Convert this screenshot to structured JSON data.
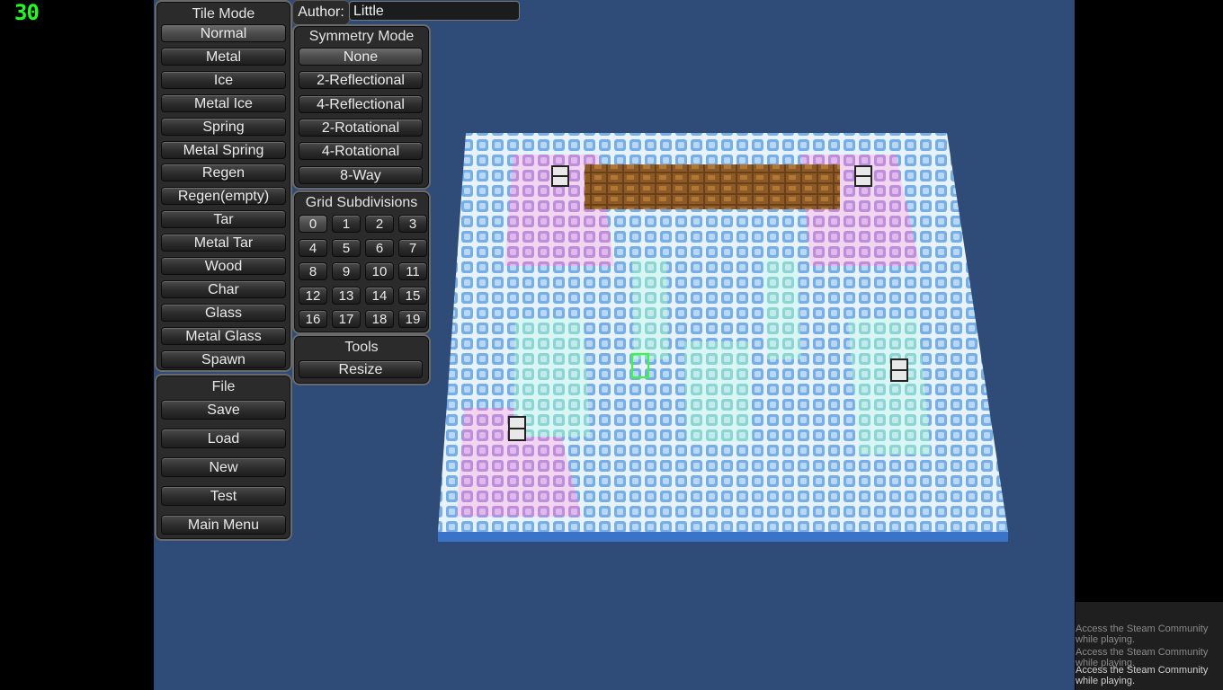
{
  "fps": "30",
  "author": {
    "label": "Author:",
    "value": "Little"
  },
  "tile_mode": {
    "title": "Tile Mode",
    "items": [
      "Normal",
      "Metal",
      "Ice",
      "Metal Ice",
      "Spring",
      "Metal Spring",
      "Regen",
      "Regen(empty)",
      "Tar",
      "Metal Tar",
      "Wood",
      "Char",
      "Glass",
      "Metal Glass",
      "Spawn"
    ],
    "selected": "Normal"
  },
  "symmetry_mode": {
    "title": "Symmetry Mode",
    "items": [
      "None",
      "2-Reflectional",
      "4-Reflectional",
      "2-Rotational",
      "4-Rotational",
      "8-Way"
    ],
    "selected": "None"
  },
  "grid_subdivisions": {
    "title": "Grid Subdivisions",
    "items": [
      "0",
      "1",
      "2",
      "3",
      "4",
      "5",
      "6",
      "7",
      "8",
      "9",
      "10",
      "11",
      "12",
      "13",
      "14",
      "15",
      "16",
      "17",
      "18",
      "19"
    ],
    "selected": "0"
  },
  "tools": {
    "title": "Tools",
    "items": [
      "Resize"
    ]
  },
  "file": {
    "title": "File",
    "items": [
      "Save",
      "Load",
      "New",
      "Test",
      "Main Menu"
    ]
  },
  "steam_notifications": [
    "Access the Steam Community while playing.",
    "Access the Steam Community while playing.",
    "Access the Steam Community while playing."
  ],
  "colors": {
    "viewport_bg": "#2f4c78",
    "ice": "#dbeeff",
    "ice_tile": "#6fa6e0",
    "pink": "#e8a8dc",
    "cyan": "#9fe6e0",
    "wood": "#7a4a1c",
    "fps": "#21ff21"
  }
}
